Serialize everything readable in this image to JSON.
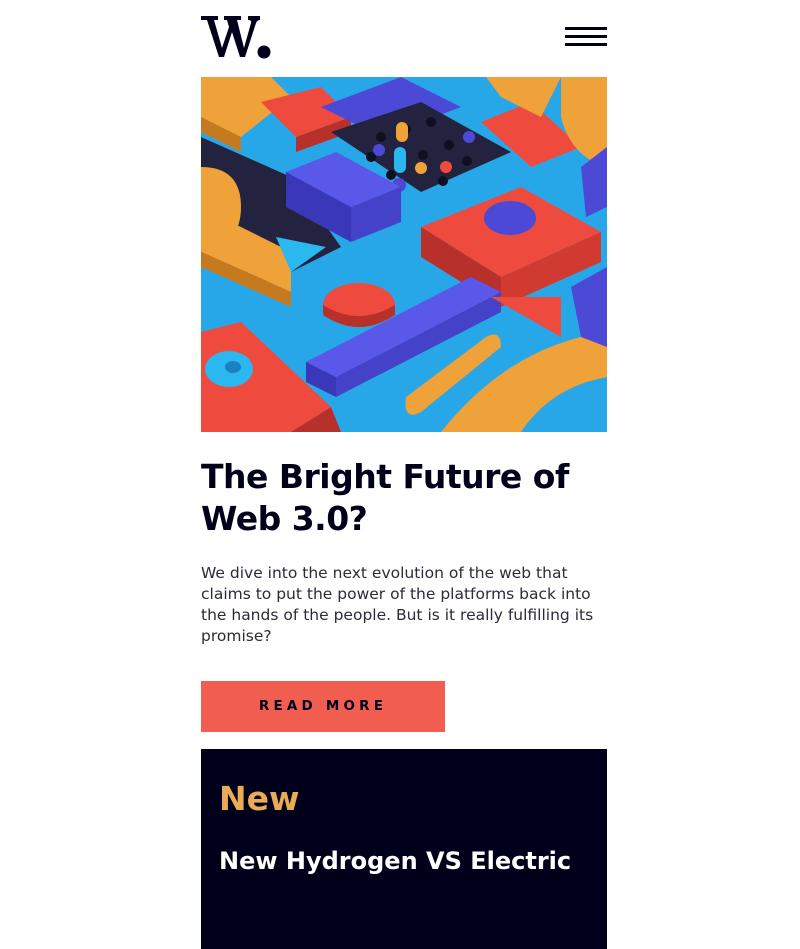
{
  "header": {
    "logo_text": "W.",
    "menu_icon": "hamburger-menu-icon"
  },
  "hero": {
    "image": "colorful-3d-blocks-illustration",
    "colors": {
      "sky": "#28a7e8",
      "orange": "#efa13a",
      "red": "#ef4a3e",
      "purple": "#4b49d6",
      "navy": "#23233f"
    }
  },
  "article": {
    "title": "The Bright Future of Web 3.0?",
    "description": "We dive into the next evolution of the web that claims to put the power of the platforms back into the hands of the people. But is it really fulfilling its promise?",
    "cta_label": "READ MORE"
  },
  "new_section": {
    "title": "New",
    "items": [
      {
        "title": "New Hydrogen VS Electric"
      }
    ]
  },
  "theme": {
    "accent": "#f15e50",
    "dark": "#00001a",
    "highlight": "#e9ab53"
  }
}
